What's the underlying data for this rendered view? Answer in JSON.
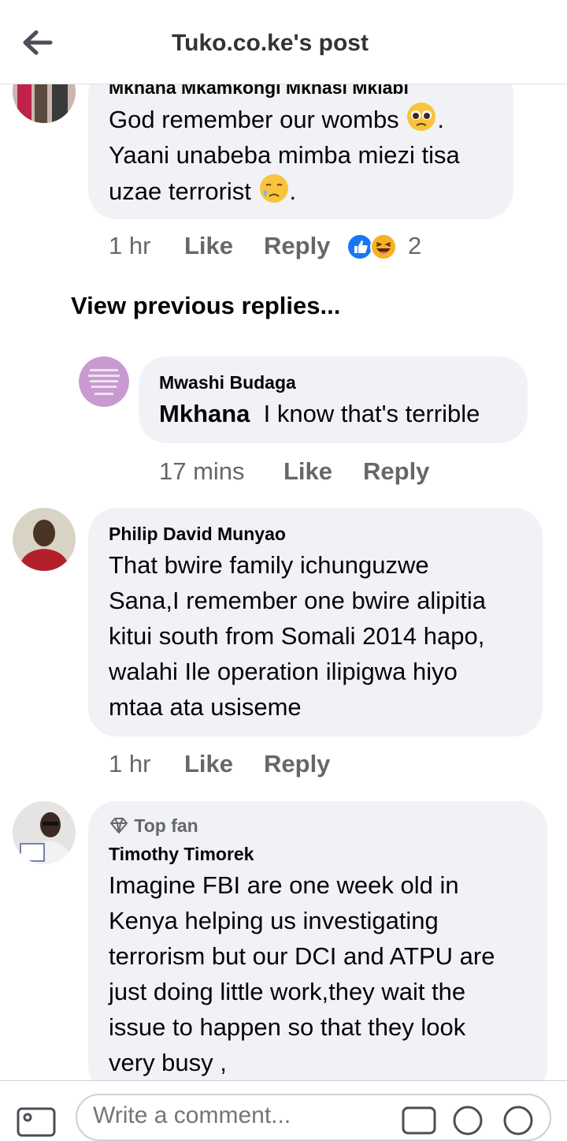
{
  "header": {
    "title": "Tuko.co.ke's post",
    "back_icon": "arrow-left-icon"
  },
  "comment1": {
    "name": "Mkhana Mkamkongi Mkhasi Mkiabi",
    "line1": "God remember our wombs",
    "line1_end": ".",
    "line2": "Yaani unabeba mimba miezi tisa",
    "line3": "uzae terrorist",
    "line3_end": ".",
    "time": "1 hr",
    "like": "Like",
    "reply": "Reply",
    "reaction_count": "2"
  },
  "view_previous": "View previous replies...",
  "reply1": {
    "name": "Mwashi Budaga",
    "mention": "Mkhana",
    "text": "I know that's terrible",
    "time": "17 mins",
    "like": "Like",
    "reply": "Reply"
  },
  "comment2": {
    "name": "Philip David Munyao",
    "lines": [
      "That bwire family ichunguzwe",
      "Sana,I remember one bwire alipitia",
      "kitui south from Somali 2014 hapo,",
      "walahi Ile operation ilipigwa hiyo",
      "mtaa ata usiseme"
    ],
    "time": "1 hr",
    "like": "Like",
    "reply": "Reply"
  },
  "comment3": {
    "badge": "Top fan",
    "name": "Timothy Timorek",
    "lines": [
      "Imagine FBI are one week old  in",
      "Kenya helping us investigating",
      "terrorism but our DCI and ATPU are",
      "just doing little work,they wait the",
      "issue to happen so that they look",
      "very busy ,"
    ]
  },
  "footer": {
    "placeholder": "Write a comment..."
  },
  "colors": {
    "bubble": "#f0f2f5",
    "meta": "#65676b",
    "like_blue": "#1877f2",
    "haha_yellow": "#f7b125"
  }
}
